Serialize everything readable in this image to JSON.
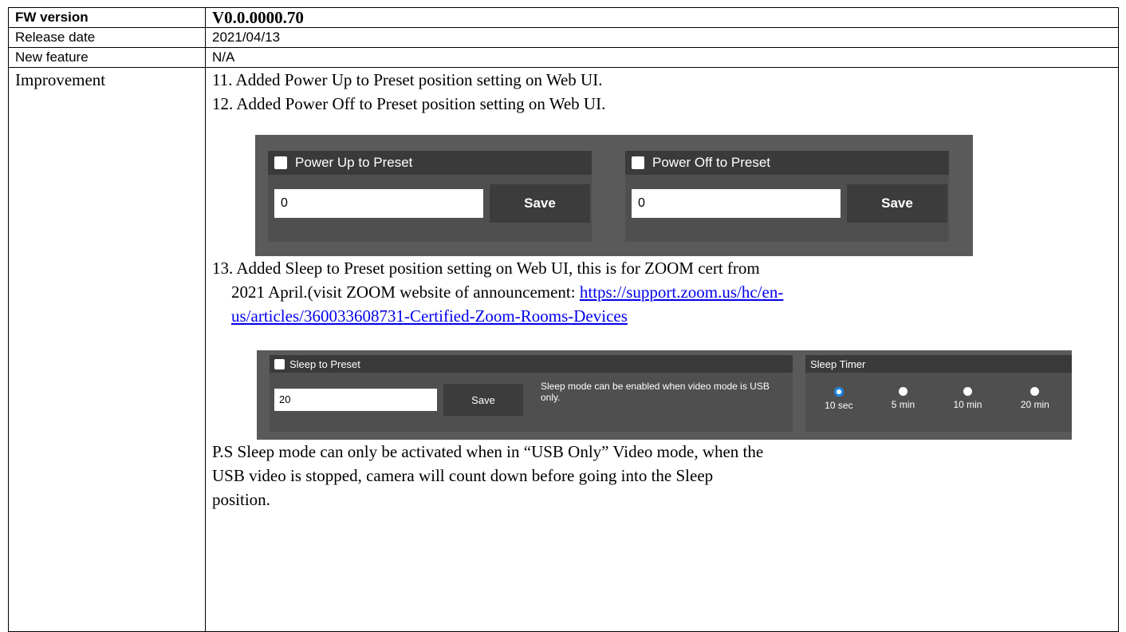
{
  "rows": {
    "fw": {
      "label": "FW version",
      "value": "V0.0.0000.70"
    },
    "release": {
      "label": "Release date",
      "value": "2021/04/13"
    },
    "feature": {
      "label": "New feature",
      "value": "N/A"
    },
    "improvement": {
      "label": "Improvement"
    }
  },
  "items": {
    "i11": "11. Added Power Up to Preset position setting on Web UI.",
    "i12": "12. Added Power Off to Preset position setting on Web UI.",
    "i13_a": "13. Added Sleep to Preset position setting on Web UI, this is for ZOOM cert from",
    "i13_b": "2021 April.(visit ZOOM website of announcement: ",
    "link_a": "https://support.zoom.us/hc/en-",
    "link_b": "us/articles/360033608731-Certified-Zoom-Rooms-Devices",
    "ps_1": "P.S Sleep mode can only be activated when in “USB Only” Video mode, when the",
    "ps_2": "USB video is stopped, camera will count down before going into the Sleep",
    "ps_3": "position."
  },
  "panel1": {
    "power_up": {
      "label": "Power Up to Preset",
      "value": "0",
      "save": "Save"
    },
    "power_off": {
      "label": "Power Off to Preset",
      "value": "0",
      "save": "Save"
    }
  },
  "panel2": {
    "sleep": {
      "label": "Sleep to Preset",
      "value": "20",
      "save": "Save",
      "note": "Sleep mode can be enabled when video mode is USB only."
    },
    "timer": {
      "label": "Sleep Timer",
      "options": [
        "10 sec",
        "5 min",
        "10 min",
        "20 min"
      ],
      "selected": "10 sec"
    }
  },
  "colors": {
    "panel_bg": "#5a5a5a",
    "box_bg": "#4f4f4f",
    "header_bg": "#3a3a3a",
    "link": "#0000ee",
    "radio_selected": "#1e88e5"
  }
}
